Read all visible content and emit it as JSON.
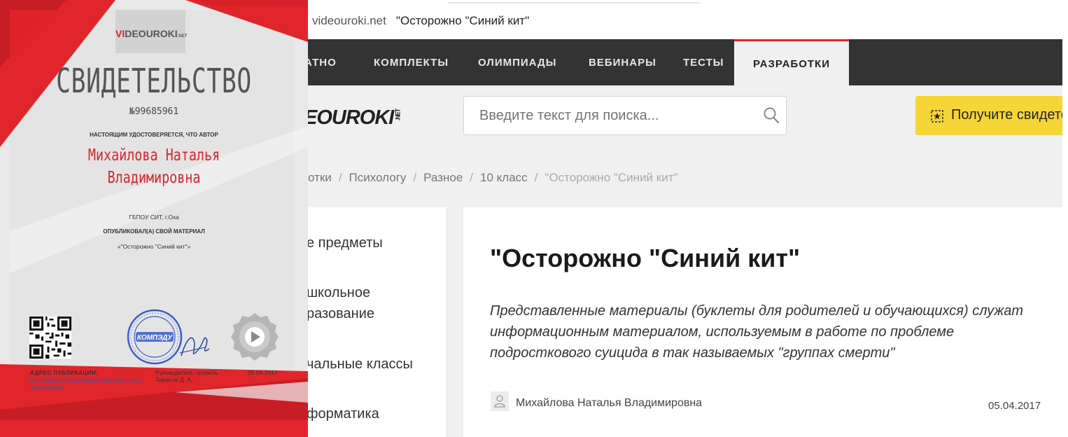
{
  "certificate": {
    "logo": {
      "part1": "VI",
      "part2": "DEOUROKI",
      "suffix": ".NET"
    },
    "title": "СВИДЕТЕЛЬСТВО",
    "number": "№99685961",
    "intro": "НАСТОЯЩИМ УДОСТОВЕРЯЕТСЯ, ЧТО АВТОР",
    "author_line1": "Михайлова Наталья",
    "author_line2": "Владимировна",
    "organization": "ГБПОУ СИТ, г.Оха",
    "published": "ОПУБЛИКОВАЛ(А) СВОЙ МАТЕРИАЛ",
    "material": "«\"Осторожно \"Синий кит\"»",
    "address_label": "АДРЕС ПУБЛИКАЦИИ:",
    "address_url": "http://videouroki.net/razrabotki/ostorozhno-sinii-kit.html",
    "leader_label": "Руководитель проекта",
    "leader_name": "Тарасов Д. А.",
    "date": "05.04.2017",
    "stamp_text": "КОМПЭДУ",
    "colors": {
      "red": "#e0262b",
      "grey": "#e4e4e4",
      "title_grey": "#555555"
    }
  },
  "browser": {
    "address_domain": "videouroki.net",
    "page_title": "\"Осторожно \"Синий кит\""
  },
  "nav": {
    "items": [
      "АТНО",
      "КОМПЛЕКТЫ",
      "ОЛИМПИАДЫ",
      "ВЕБИНАРЫ",
      "ТЕСТЫ",
      "РАЗРАБОТКИ"
    ],
    "active": "РАЗРАБОТКИ",
    "accent": "#e0262b"
  },
  "header": {
    "logo_text": "EOUROKI",
    "logo_suffix": ".NET",
    "search_placeholder": "Введите текст для поиска...",
    "cta_label": "Получите свидетел",
    "cta_color": "#f6d536"
  },
  "breadcrumb": [
    "отки",
    "Психологу",
    "Разное",
    "10 класс",
    "\"Осторожно \"Синий кит\""
  ],
  "sidebar": {
    "items": [
      "е предметы",
      "школьное",
      "разование",
      "чальные классы",
      "форматика"
    ]
  },
  "article": {
    "title": "\"Осторожно \"Синий кит\"",
    "description": "Представленные материалы (буклеты для родителей и обучающихся) служат информационным материалом, используемым в работе по проблеме подросткового суицида в так называемых \"группах смерти\"",
    "author": "Михайлова Наталья Владимировна",
    "date": "05.04.2017"
  }
}
